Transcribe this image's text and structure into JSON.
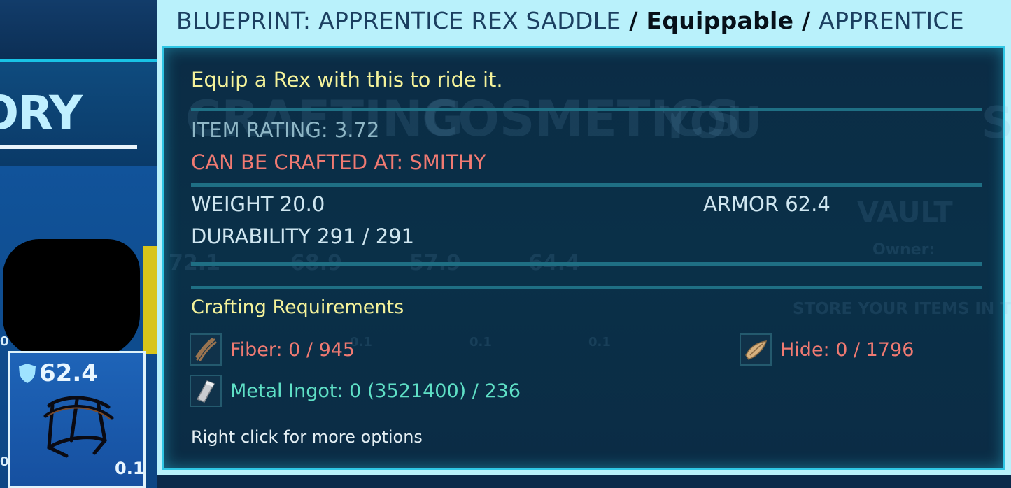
{
  "background": {
    "section_title": "TORY",
    "equipped_slot": {
      "armor": "62.4",
      "weight": "0.1"
    },
    "side_values": [
      "0",
      "0."
    ],
    "ghost_texts": [
      "CRAFTING",
      "COSMETICS",
      "YOU",
      "S",
      "VAULT",
      "Owner:",
      "STORE YOUR ITEMS IN TH",
      "72.1",
      "68.9",
      "57.9",
      "64.4",
      "0.1",
      "0.1",
      "0.1"
    ]
  },
  "tooltip": {
    "header": {
      "name": "BLUEPRINT: APPRENTICE REX SADDLE",
      "sep1": " / ",
      "type": "Equippable",
      "sep2": " / ",
      "quality": "APPRENTICE"
    },
    "description": "Equip a Rex with this to ride it.",
    "item_rating": "ITEM RATING: 3.72",
    "crafted_at": "CAN BE CRAFTED AT: SMITHY",
    "stats": {
      "weight": "WEIGHT 20.0",
      "armor": "ARMOR 62.4",
      "durability": "DURABILITY 291 / 291"
    },
    "requirements_title": "Crafting Requirements",
    "requirements": [
      {
        "icon": "fiber-icon",
        "label": "Fiber: 0 / 945",
        "status": "missing"
      },
      {
        "icon": "hide-icon",
        "label": "Hide: 0 / 1796",
        "status": "missing"
      },
      {
        "icon": "metal-ingot-icon",
        "label": "Metal Ingot: 0 (3521400) / 236",
        "status": "available"
      }
    ],
    "hint": "Right click for more options"
  },
  "colors": {
    "frame": "#b9f1fb",
    "panel": "#0b2c45",
    "border": "#2fc6e4",
    "description": "#f4f29a",
    "missing": "#f07a72",
    "available": "#5fe0c6",
    "stat": "#cfe6f0"
  }
}
